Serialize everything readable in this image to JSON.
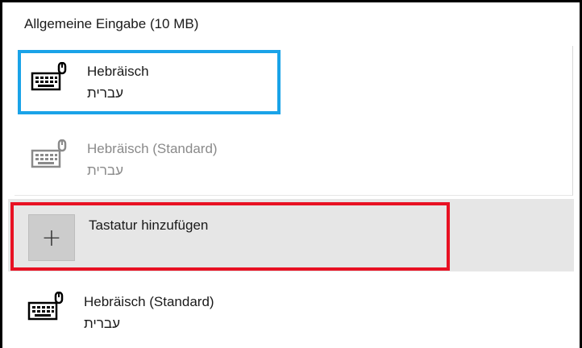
{
  "section": {
    "title": "Allgemeine Eingabe (10 MB)"
  },
  "keyboards": [
    {
      "name": "Hebräisch",
      "sub": "עברית",
      "icon": "keyboard-icon",
      "state": "selected"
    },
    {
      "name": "Hebräisch (Standard)",
      "sub": "עברית",
      "icon": "keyboard-icon",
      "state": "disabled"
    }
  ],
  "add_keyboard": {
    "label": "Tastatur hinzufügen",
    "icon": "plus-icon"
  },
  "standard_keyboard": {
    "name": "Hebräisch (Standard)",
    "sub": "עברית",
    "icon": "keyboard-icon"
  },
  "colors": {
    "highlight_blue": "#1aa3e8",
    "highlight_red": "#e81123",
    "row_hover": "#e6e6e6"
  }
}
